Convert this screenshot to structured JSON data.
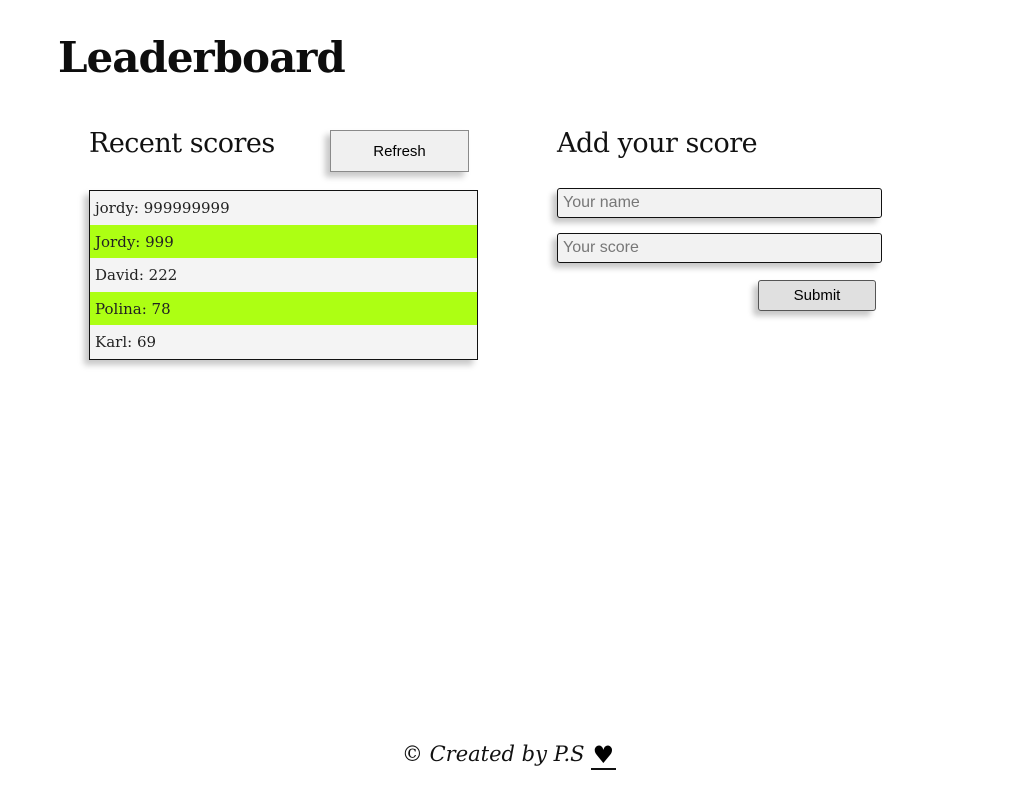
{
  "page": {
    "title": "Leaderboard"
  },
  "recent": {
    "title": "Recent scores",
    "refresh_label": "Refresh",
    "scores": [
      {
        "text": "jordy: 999999999"
      },
      {
        "text": "Jordy: 999"
      },
      {
        "text": "David: 222"
      },
      {
        "text": "Polina: 78"
      },
      {
        "text": "Karl: 69"
      }
    ],
    "highlight_color": "#adff13"
  },
  "add": {
    "title": "Add your score",
    "name_placeholder": "Your name",
    "score_placeholder": "Your score",
    "name_value": "",
    "score_value": "",
    "submit_label": "Submit"
  },
  "footer": {
    "text": "© Created by P.S",
    "heart_icon": "heart-icon",
    "heart_glyph": "♥"
  }
}
